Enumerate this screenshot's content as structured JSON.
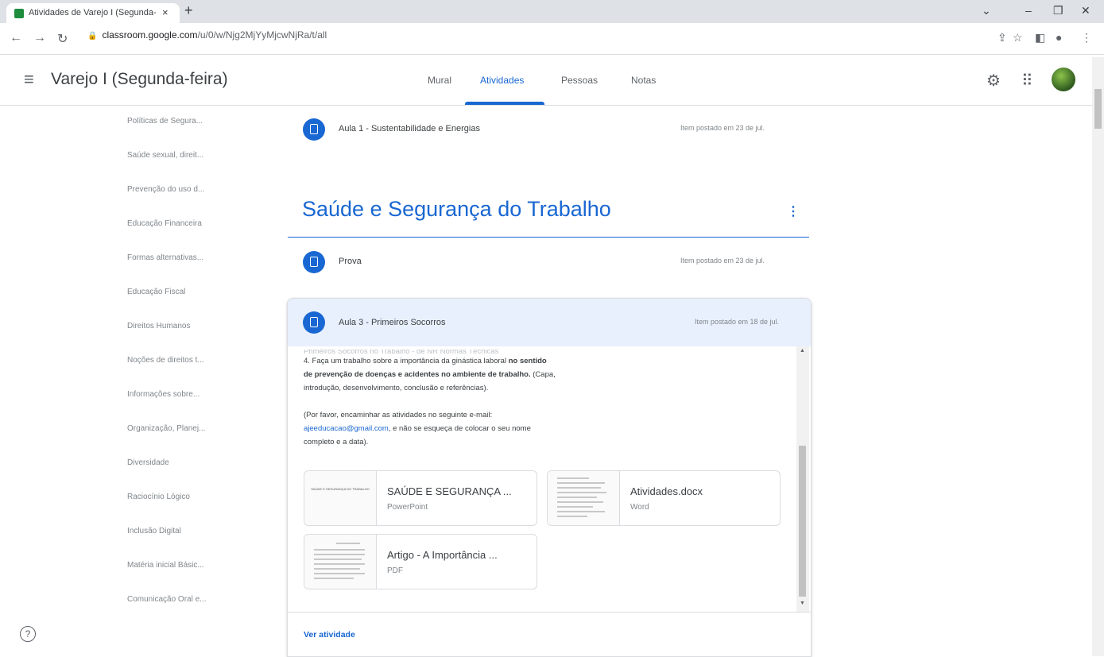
{
  "browser": {
    "tab_title": "Atividades de Varejo I (Segunda-",
    "tab_close": "×",
    "new_tab": "+",
    "url_host": "classroom.google.com",
    "url_path": "/u/0/w/Njg2MjYyMjcwNjRa/t/all"
  },
  "header": {
    "course_title": "Varejo I (Segunda-feira)",
    "tabs": [
      "Mural",
      "Atividades",
      "Pessoas",
      "Notas"
    ],
    "active_tab": "Atividades"
  },
  "sidebar": {
    "items": [
      "Políticas de Segura...",
      "Saúde sexual, direit...",
      "Prevenção do uso d...",
      "Educação Financeira",
      "Formas alternativas...",
      "Educação Fiscal",
      "Direitos Humanos",
      "Noções de direitos t...",
      "Informações sobre...",
      "Organização, Planej...",
      "Diversidade",
      "Raciocínio Lógico",
      "Inclusão Digital",
      "Matéria inicial Básic...",
      "Comunicação Oral e..."
    ]
  },
  "main": {
    "top_item": {
      "title": "Aula 1 - Sustentabilidade e Energias",
      "date": "Item postado em 23 de jul."
    },
    "topic_title": "Saúde e Segurança do Trabalho",
    "topic_menu": "⋮",
    "items": [
      {
        "title": "Prova",
        "date": "Item postado em 23 de jul."
      }
    ],
    "expanded": {
      "title": "Aula 3 - Primeiros Socorros",
      "date": "Item postado em 18 de jul.",
      "cut_line": "Primeiros Socorros no Trabalho - de NR Normas Técnicas",
      "line1": "4. Faça um trabalho sobre a importância da ginástica laboral",
      "bold1": "no sentido",
      "bold2": "de prevenção de doenças e acidentes no ambiente de trabalho.",
      "line2_rest": "(Capa,",
      "line3": "introdução, desenvolvimento, conclusão e referências).",
      "line4": "(Por favor, encaminhar as atividades no seguinte e-mail:",
      "email": "ajeeducacao@gmail.com",
      "line5_rest": ", e não se esqueça de colocar o seu nome",
      "line6": "completo e a data).",
      "attachments": [
        {
          "name": "SAÚDE E SEGURANÇA ...",
          "type": "PowerPoint",
          "thumb_text": "SAÚDE E SEGURANÇA DO TRABALHO"
        },
        {
          "name": "Atividades.docx",
          "type": "Word"
        },
        {
          "name": "Artigo - A Importância ...",
          "type": "PDF"
        }
      ],
      "view_link": "Ver atividade"
    }
  },
  "help_label": "?"
}
